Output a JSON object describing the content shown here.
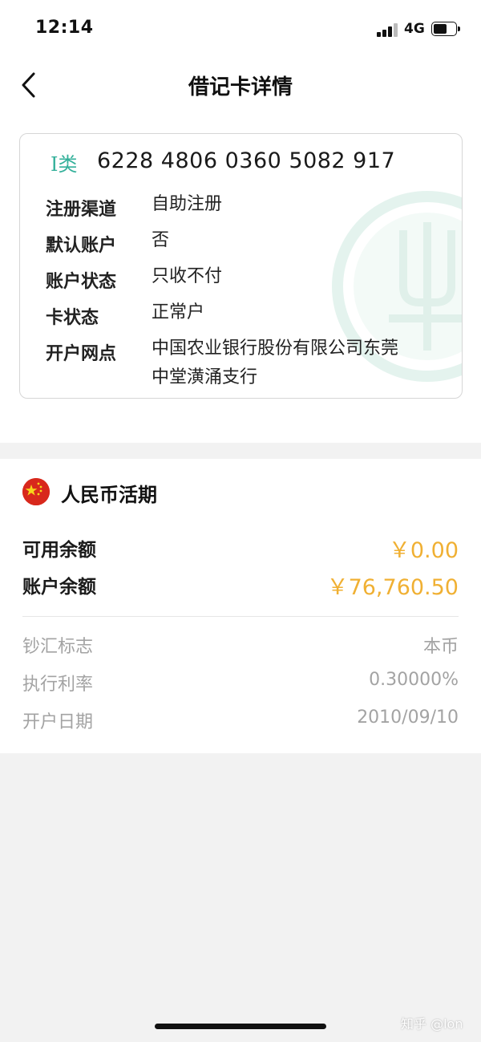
{
  "status_bar": {
    "time": "12:14",
    "network": "4G",
    "signal_bars_filled": 3,
    "battery_level": 0.6
  },
  "nav": {
    "title": "借记卡详情",
    "back_icon": "chevron-left-icon"
  },
  "card": {
    "class_label": "I类",
    "number": "6228 4806 0360 5082 917",
    "class_color": "#33b09a",
    "watermark_icon": "abc-bank-logo-icon",
    "fields": [
      {
        "label": "注册渠道",
        "value": "自助注册"
      },
      {
        "label": "默认账户",
        "value": "否"
      },
      {
        "label": "账户状态",
        "value": "只收不付"
      },
      {
        "label": "卡状态",
        "value": "正常户"
      },
      {
        "label": "开户网点",
        "value_line1": "中国农业银行股份有限公司东莞",
        "value_line2": "中堂潢涌支行"
      }
    ]
  },
  "account": {
    "flag_icon": "china-flag-icon",
    "title": "人民币活期",
    "balances": [
      {
        "label": "可用余额",
        "value": "￥0.00"
      },
      {
        "label": "账户余额",
        "value": "￥76,760.50"
      }
    ],
    "meta": [
      {
        "label": "钞汇标志",
        "value": "本币"
      },
      {
        "label": "执行利率",
        "value": "0.30000%"
      },
      {
        "label": "开户日期",
        "value": "2010/09/10"
      }
    ],
    "amount_color": "#f0b033"
  },
  "footer": {
    "watermark": "知乎 @lon"
  }
}
